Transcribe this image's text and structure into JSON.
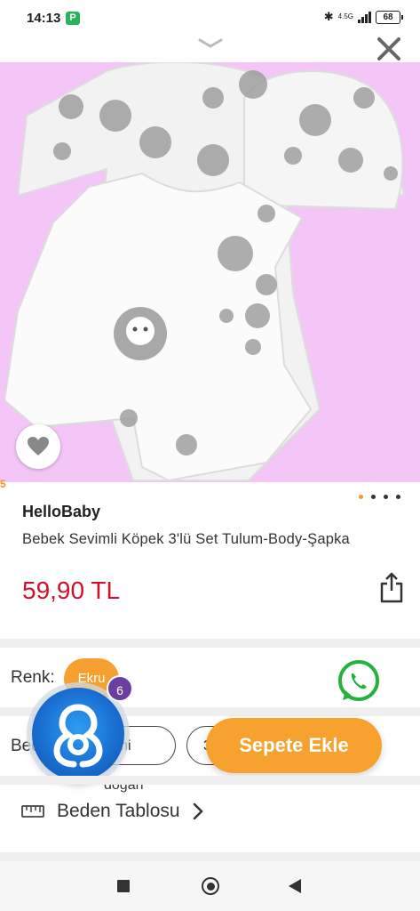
{
  "status_bar": {
    "time": "14:13",
    "app_badge": "P",
    "network": "4.5G",
    "battery": "68"
  },
  "product": {
    "brand": "HelloBaby",
    "name": "Bebek Sevimli Köpek 3'lü Set Tulum-Body-Şapka",
    "price": "59,90 TL",
    "image_edge_number": "5",
    "image_count": 4,
    "active_image_index": 0
  },
  "options": {
    "color_label": "Renk:",
    "color_value": "Ekru",
    "size_label": "Beden:",
    "sizes": [
      "Yeni doğan",
      "3-6 Ay"
    ],
    "size_table_label": "Beden Tablosu"
  },
  "actions": {
    "add_to_cart": "Sepete Ekle"
  },
  "chat_widget": {
    "badge_count": "6"
  },
  "colors": {
    "accent": "#f7a22e",
    "price": "#d0112b",
    "image_bg": "#f3c6f7",
    "whatsapp": "#25b13e"
  },
  "icons": [
    "chevron-down-icon",
    "close-icon",
    "heart-icon",
    "share-icon",
    "whatsapp-icon",
    "ruler-icon",
    "chevron-right-icon"
  ]
}
